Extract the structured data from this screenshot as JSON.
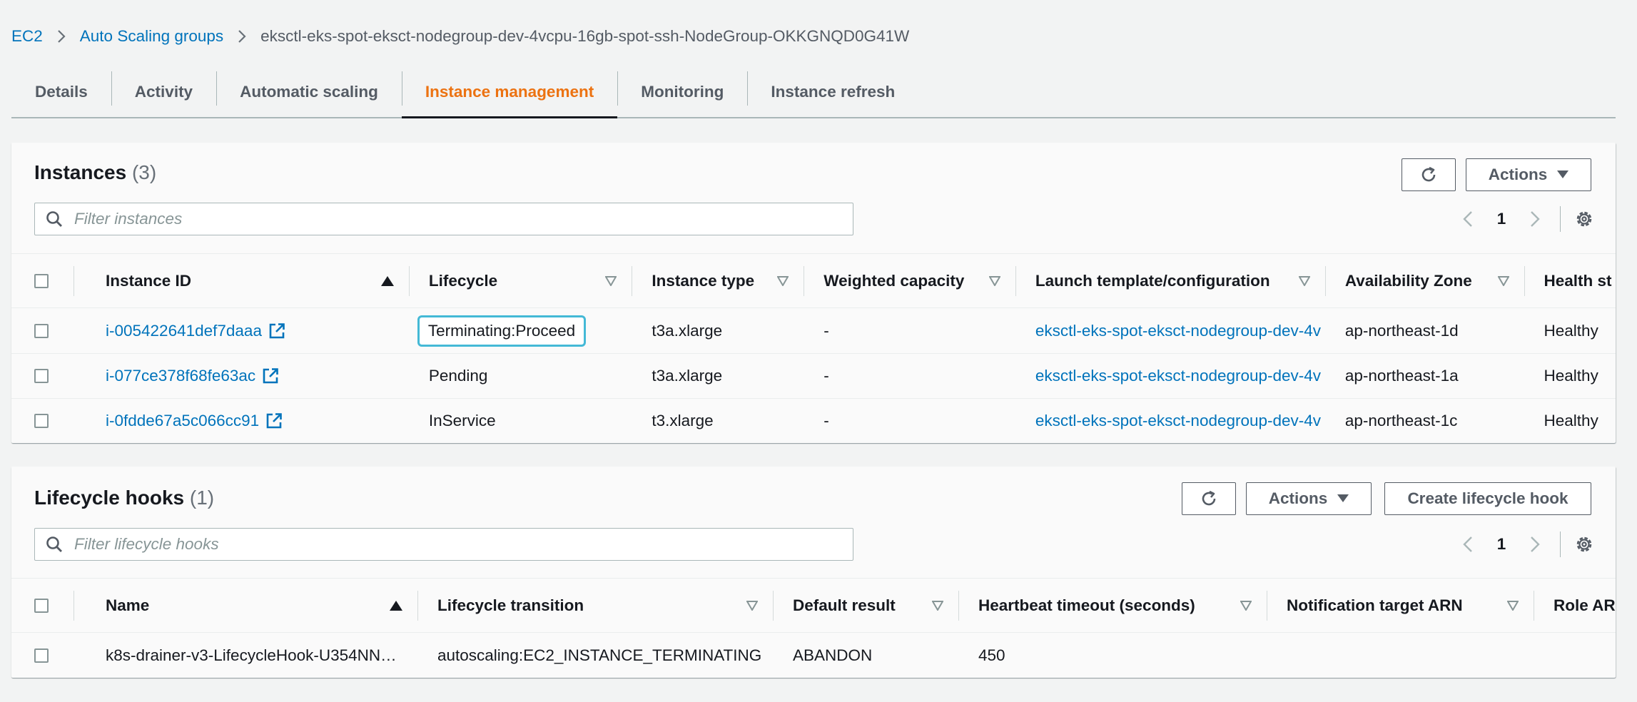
{
  "breadcrumb": {
    "items": [
      "EC2",
      "Auto Scaling groups"
    ],
    "current": "eksctl-eks-spot-eksct-nodegroup-dev-4vcpu-16gb-spot-ssh-NodeGroup-OKKGNQD0G41W"
  },
  "tabs": [
    "Details",
    "Activity",
    "Automatic scaling",
    "Instance management",
    "Monitoring",
    "Instance refresh"
  ],
  "active_tab": "Instance management",
  "colors": {
    "accent": "#ec7211",
    "link": "#0073bb",
    "highlight": "#44b9d6",
    "background": "#f2f3f3"
  },
  "instances": {
    "title": "Instances",
    "count": "(3)",
    "actions_label": "Actions",
    "filter_placeholder": "Filter instances",
    "page": "1",
    "columns": [
      "Instance ID",
      "Lifecycle",
      "Instance type",
      "Weighted capacity",
      "Launch template/configuration",
      "Availability Zone",
      "Health st"
    ],
    "rows": [
      {
        "id": "i-005422641def7daaa",
        "lifecycle": "Terminating:Proceed",
        "type": "t3a.xlarge",
        "weight": "-",
        "template": "eksctl-eks-spot-eksct-nodegroup-dev-4v",
        "az": "ap-northeast-1d",
        "health": "Healthy"
      },
      {
        "id": "i-077ce378f68fe63ac",
        "lifecycle": "Pending",
        "type": "t3a.xlarge",
        "weight": "-",
        "template": "eksctl-eks-spot-eksct-nodegroup-dev-4v",
        "az": "ap-northeast-1a",
        "health": "Healthy"
      },
      {
        "id": "i-0fdde67a5c066cc91",
        "lifecycle": "InService",
        "type": "t3.xlarge",
        "weight": "-",
        "template": "eksctl-eks-spot-eksct-nodegroup-dev-4v",
        "az": "ap-northeast-1c",
        "health": "Healthy"
      }
    ]
  },
  "hooks": {
    "title": "Lifecycle hooks",
    "count": "(1)",
    "actions_label": "Actions",
    "create_label": "Create lifecycle hook",
    "filter_placeholder": "Filter lifecycle hooks",
    "page": "1",
    "columns": [
      "Name",
      "Lifecycle transition",
      "Default result",
      "Heartbeat timeout (seconds)",
      "Notification target ARN",
      "Role ARI"
    ],
    "rows": [
      {
        "name": "k8s-drainer-v3-LifecycleHook-U354NN…",
        "transition": "autoscaling:EC2_INSTANCE_TERMINATING",
        "result": "ABANDON",
        "timeout": "450",
        "target": "",
        "role": ""
      }
    ]
  }
}
